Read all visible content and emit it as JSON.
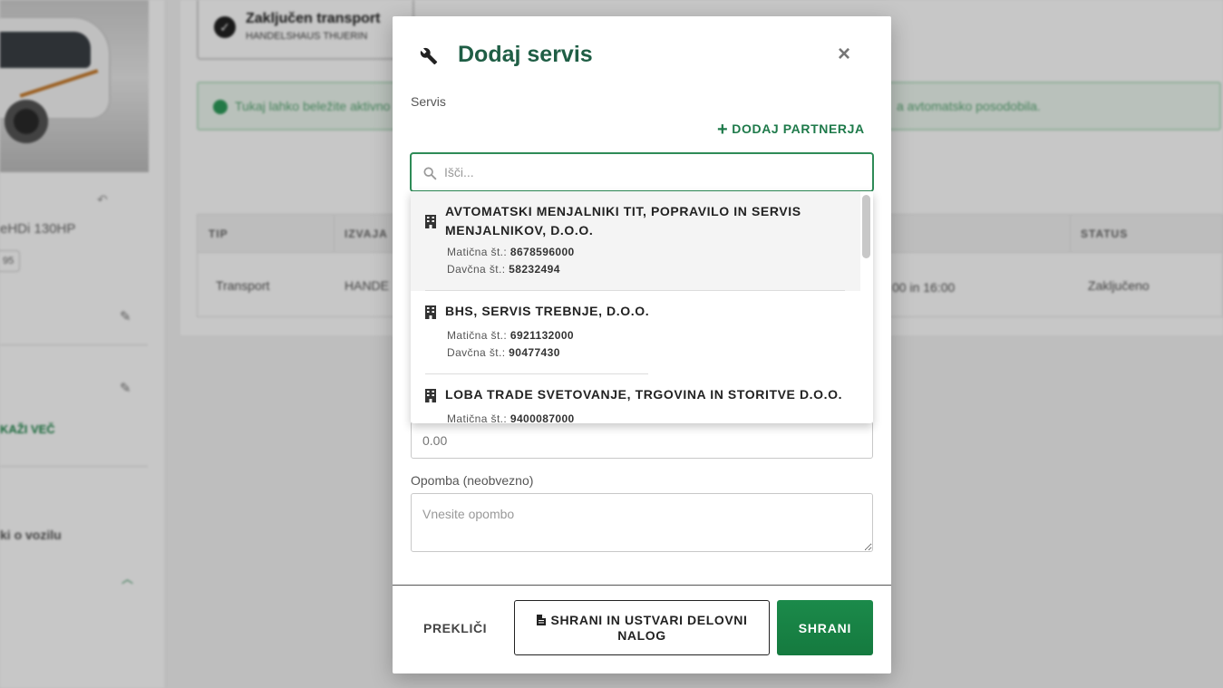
{
  "background": {
    "vehicle_model": "eHDi 130HP",
    "chip_text": "95",
    "show_more": "KAŽI VEČ",
    "vehicle_info": "ki o vozilu",
    "card_title": "Zaključen transport",
    "card_subtitle": "HANDELSHAUS THUERIN",
    "info_text_left": "Tukaj lahko beležite aktivno",
    "info_text_right": "a avtomatsko posodobila.",
    "table_headers": [
      "TIP",
      "IZVAJA",
      "STATUS"
    ],
    "table_row": {
      "tip": "Transport",
      "izvaja": "HANDE",
      "time": "00 in 16:00",
      "status": "Zaključeno"
    }
  },
  "modal": {
    "title": "Dodaj servis",
    "title_icon": "wrench-icon",
    "close_label": "×",
    "servis_label": "Servis",
    "add_partner_label": "DODAJ PARTNERJA",
    "search": {
      "placeholder": "Išči..."
    },
    "partners": [
      {
        "name": "AVTOMATSKI MENJALNIKI TIT, POPRAVILO IN SERVIS MENJALNIKOV, D.O.O.",
        "maticna_label": "Matična št.:",
        "maticna": "8678596000",
        "davcna_label": "Davčna št.:",
        "davcna": "58232494"
      },
      {
        "name": "BHS, SERVIS TREBNJE, D.O.O.",
        "maticna_label": "Matična št.:",
        "maticna": "6921132000",
        "davcna_label": "Davčna št.:",
        "davcna": "90477430"
      },
      {
        "name": "LOBA TRADE SVETOVANJE, TRGOVINA IN STORITVE D.O.O.",
        "maticna_label": "Matična št.:",
        "maticna": "9400087000"
      }
    ],
    "amount": {
      "placeholder": "0.00"
    },
    "note_label": "Opomba (neobvezno)",
    "note": {
      "placeholder": "Vnesite opombo"
    },
    "buttons": {
      "cancel": "PREKLIČI",
      "save_and_order": "SHRANI IN USTVARI DELOVNI NALOG",
      "save": "SHRANI"
    }
  },
  "colors": {
    "accent": "#1e7a4a",
    "title": "#1f5e45",
    "save_button": "#1b8a4a"
  }
}
